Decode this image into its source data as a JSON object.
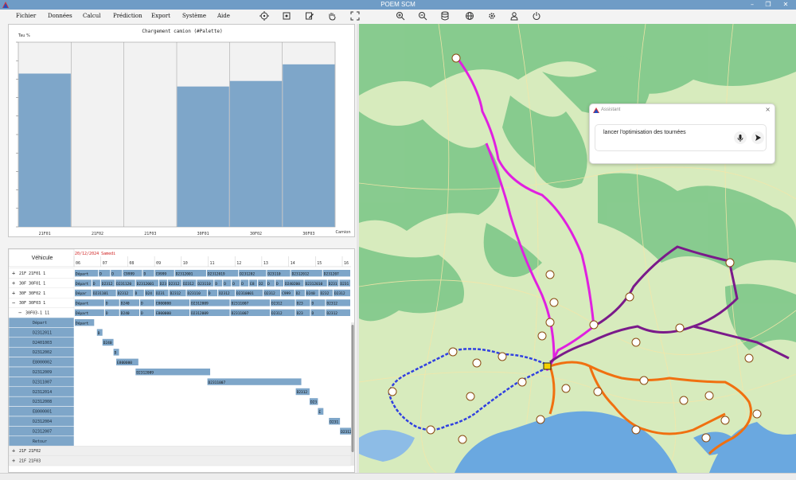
{
  "window": {
    "title": "POEM SCM"
  },
  "menu": [
    "Fichier",
    "Données",
    "Calcul",
    "Prédiction",
    "Export",
    "Système",
    "Aide"
  ],
  "toolbar_icons": [
    "target-icon",
    "fit-screen-icon",
    "edit-icon",
    "hand-pan-icon",
    "expand-icon",
    "zoom-in-icon",
    "zoom-out-icon",
    "database-icon",
    "globe-icon",
    "settings-icon",
    "user-icon",
    "power-icon"
  ],
  "chart_data": {
    "type": "bar",
    "title": "Chargement camion (#Palette)",
    "ylabel": "Tau %",
    "xlabel": "Camion",
    "categories": [
      "21F01",
      "21F02",
      "21F03",
      "30F01",
      "30F02",
      "30F03"
    ],
    "values": [
      83,
      0,
      0,
      76,
      79,
      88
    ],
    "ylim": [
      0,
      100
    ],
    "grid": true,
    "bar_color": "#7ea6c9"
  },
  "gantt": {
    "column_header": "Véhicule",
    "date": "20/12/2024 Samedi",
    "date_color": "#d02020",
    "hours": [
      "06",
      "07",
      "08",
      "09",
      "10",
      "11",
      "12",
      "13",
      "14",
      "15",
      "16"
    ],
    "rows": [
      {
        "label": "21F 21F01  1",
        "type": "vehicle",
        "expander": "+",
        "bars": [
          "Départ",
          "D",
          "D",
          "C9999",
          "D",
          "C9999",
          "D2312001",
          "D2312019",
          "D231202",
          "D23110",
          "D2312012",
          "D231207"
        ]
      },
      {
        "label": "30F 30F01  1",
        "type": "vehicle",
        "expander": "+",
        "bars": [
          "Départ",
          "D",
          "D2312",
          "D231120",
          "D2312001",
          "D23",
          "D2312",
          "D2312",
          "D23110",
          "D",
          "D",
          "D",
          "D",
          "E8",
          "D2",
          "D",
          "D",
          "D240200",
          "D2312010",
          "D231",
          "D231"
        ]
      },
      {
        "label": "30F 30F02  1",
        "type": "vehicle",
        "expander": "+",
        "bars": [
          "Dépar",
          "D231101",
          "D2312",
          "D",
          "D24",
          "D231",
          "D2312",
          "D23110",
          "D",
          "D2312",
          "D2310001",
          "D2312",
          "C999",
          "D2",
          "D240",
          "D232",
          "D2312"
        ]
      },
      {
        "label": "30F 30F03  1",
        "type": "vehicle",
        "expander": "−",
        "bars": [
          "Départ",
          "D",
          "D240",
          "D",
          "E800000",
          "D2312009",
          "D2311007",
          "D2312",
          "D23",
          "D",
          "D2312"
        ]
      },
      {
        "label": "30F03-1  11",
        "type": "trip",
        "expander": "−",
        "bars": [
          "Départ",
          "D",
          "D240",
          "D",
          "E800000",
          "D2312009",
          "D2311007",
          "D2312",
          "D23",
          "D",
          "D2312"
        ]
      }
    ],
    "stops": [
      {
        "label": "Départ",
        "bar": "Départ"
      },
      {
        "label": "D2312011",
        "bar": "D"
      },
      {
        "label": "D2401003",
        "bar": "D240"
      },
      {
        "label": "D2312002",
        "bar": "D"
      },
      {
        "label": "E8000002",
        "bar": "E800000"
      },
      {
        "label": "D2312009",
        "bar": "D2312009"
      },
      {
        "label": "D2311007",
        "bar": "D2311007"
      },
      {
        "label": "D2312014",
        "bar": "D2312"
      },
      {
        "label": "D2312008",
        "bar": "D23"
      },
      {
        "label": "E8000001",
        "bar": "E"
      },
      {
        "label": "D2312004",
        "bar": "D231"
      },
      {
        "label": "D2312007",
        "bar": "D2312"
      },
      {
        "label": "Retour",
        "bar": ""
      }
    ],
    "collapsed": [
      {
        "label": "21F 21F02",
        "expander": "+"
      },
      {
        "label": "21F 21F03",
        "expander": "+"
      }
    ]
  },
  "assistant": {
    "title": "Assistant",
    "close": "×",
    "message": "lancer l'optimisation des tournées",
    "mic_icon": "microphone-icon",
    "send_icon": "send-icon"
  },
  "map": {
    "route_colors": {
      "magenta": "#e020e0",
      "purple": "#7a1a8a",
      "blue": "#3040e0",
      "orange": "#f07010"
    }
  }
}
